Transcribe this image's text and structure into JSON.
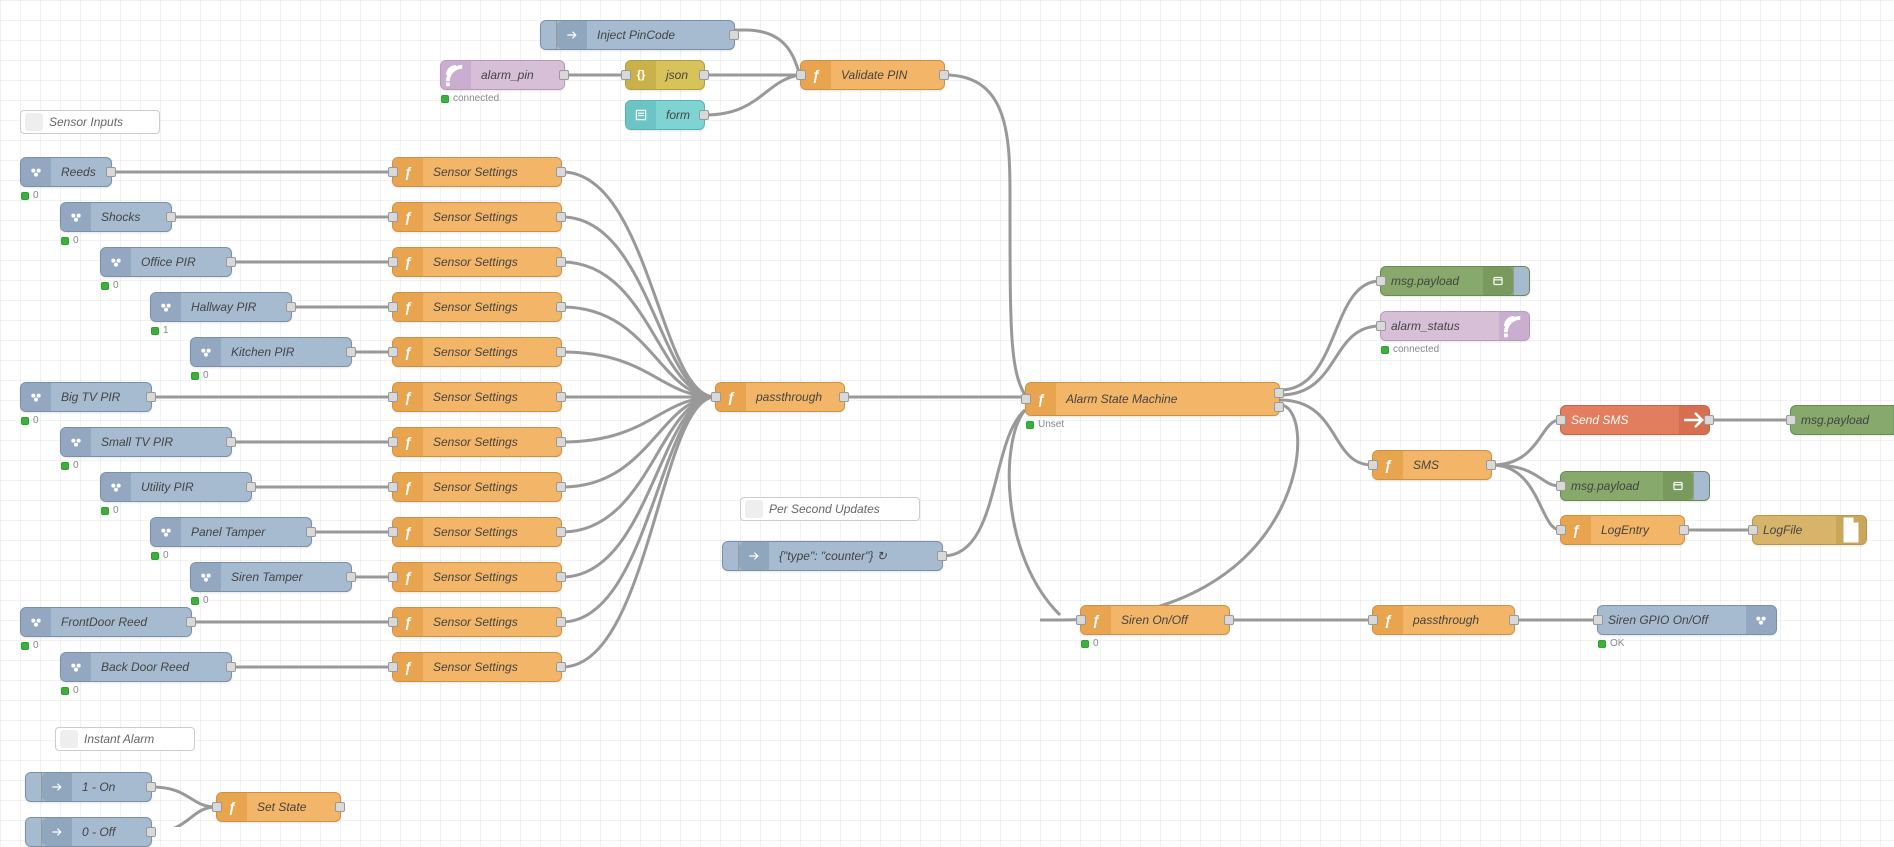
{
  "comments": {
    "sensor_inputs": "Sensor Inputs",
    "per_second": "Per Second Updates",
    "instant_alarm": "Instant Alarm"
  },
  "inject": {
    "pincode": "Inject PinCode",
    "counter": "{\"type\": \"counter\"} ↻",
    "on": "1 - On",
    "off": "0 - Off"
  },
  "mqtt_in": {
    "alarm_pin": "alarm_pin",
    "alarm_pin_status": "connected"
  },
  "mqtt_out": {
    "alarm_status": "alarm_status",
    "alarm_status_status": "connected"
  },
  "json": {
    "label": "json"
  },
  "form": {
    "label": "form"
  },
  "func": {
    "validate_pin": "Validate PIN",
    "sensor_settings": "Sensor Settings",
    "passthrough": "passthrough",
    "alarm_sm": "Alarm State Machine",
    "alarm_sm_status": "Unset",
    "sms": "SMS",
    "logentry": "LogEntry",
    "siren_onoff": "Siren On/Off",
    "siren_status": "0",
    "passthrough2": "passthrough",
    "set_state": "Set State"
  },
  "debug": {
    "msg_payload": "msg.payload"
  },
  "send_sms": "Send SMS",
  "logfile": "LogFile",
  "siren_gpio": "Siren GPIO On/Off",
  "siren_gpio_status": "OK",
  "rpi": {
    "reeds": {
      "label": "Reeds",
      "status": "0"
    },
    "shocks": {
      "label": "Shocks",
      "status": "0"
    },
    "office_pir": {
      "label": "Office PIR",
      "status": "0"
    },
    "hallway_pir": {
      "label": "Hallway PIR",
      "status": "1"
    },
    "kitchen_pir": {
      "label": "Kitchen PIR",
      "status": "0"
    },
    "bigtv_pir": {
      "label": "Big TV PIR",
      "status": "0"
    },
    "smalltv_pir": {
      "label": "Small TV PIR",
      "status": "0"
    },
    "utility_pir": {
      "label": "Utility PIR",
      "status": "0"
    },
    "panel_tamper": {
      "label": "Panel Tamper",
      "status": "0"
    },
    "siren_tamper": {
      "label": "Siren Tamper",
      "status": "0"
    },
    "front_reed": {
      "label": "FrontDoor Reed",
      "status": "0"
    },
    "back_reed": {
      "label": "Back Door Reed",
      "status": "0"
    }
  }
}
